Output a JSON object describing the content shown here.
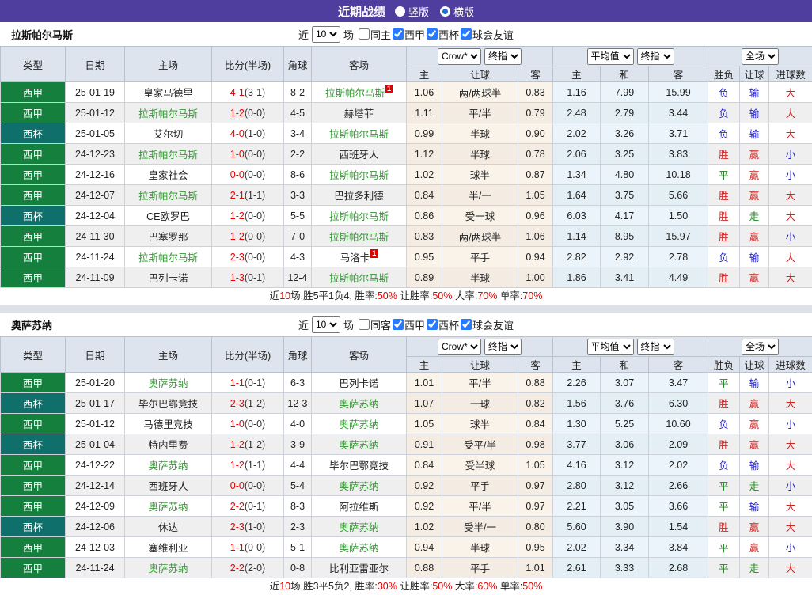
{
  "title_bar": {
    "title": "近期战绩",
    "radios": [
      {
        "label": "竖版",
        "selected": false
      },
      {
        "label": "横版",
        "selected": true
      }
    ]
  },
  "colors": {
    "accent_purple": "#4f3e9d",
    "liga_badge_green": "#15803d",
    "cup_badge_teal": "#0e6f6b",
    "focus_team_green": "#339933",
    "score_red": "#e60000",
    "result_red": "#d02525",
    "result_green": "#1f8a1f",
    "result_blue": "#2525cc",
    "crow_col_bg": "#faf3ea",
    "avg_col_bg": "#eaf4fa",
    "header_bg": "#dee4ed"
  },
  "sections": [
    {
      "team": "拉斯帕尔马斯",
      "filters": {
        "near_label": "近",
        "count": "10",
        "games_label": "场",
        "checks": [
          {
            "label": "同主",
            "checked": false
          },
          {
            "label": "西甲",
            "checked": true
          },
          {
            "label": "西杯",
            "checked": true
          },
          {
            "label": "球会友谊",
            "checked": true
          }
        ]
      },
      "header": {
        "cols": [
          "类型",
          "日期",
          "主场",
          "比分(半场)",
          "角球",
          "客场"
        ],
        "selects": {
          "crow": "Crow*",
          "final1": "终指",
          "avg": "平均值",
          "final2": "终指",
          "full": "全场"
        },
        "subs": [
          "主",
          "让球",
          "客",
          "主",
          "和",
          "客",
          "胜负",
          "让球",
          "进球数"
        ]
      },
      "rows": [
        {
          "league": "西甲",
          "date": "25-01-19",
          "home": "皇家马德里",
          "homeGreen": false,
          "homeCard": "",
          "score": "4-1",
          "half": "(3-1)",
          "corner": "8-2",
          "away": "拉斯帕尔马斯",
          "awayGreen": true,
          "awayCard": "1",
          "crowHome": "1.06",
          "handicap": "两/两球半",
          "crowAway": "0.83",
          "avgHome": "1.16",
          "avgDraw": "7.99",
          "avgAway": "15.99",
          "resWdl": "负",
          "resHandicap": "输",
          "resGoals": "大"
        },
        {
          "league": "西甲",
          "date": "25-01-12",
          "home": "拉斯帕尔马斯",
          "homeGreen": true,
          "homeCard": "",
          "score": "1-2",
          "half": "(0-0)",
          "corner": "4-5",
          "away": "赫塔菲",
          "awayGreen": false,
          "awayCard": "",
          "crowHome": "1.11",
          "handicap": "平/半",
          "crowAway": "0.79",
          "avgHome": "2.48",
          "avgDraw": "2.79",
          "avgAway": "3.44",
          "resWdl": "负",
          "resHandicap": "输",
          "resGoals": "大"
        },
        {
          "league": "西杯",
          "date": "25-01-05",
          "home": "艾尔切",
          "homeGreen": false,
          "homeCard": "",
          "score": "4-0",
          "half": "(1-0)",
          "corner": "3-4",
          "away": "拉斯帕尔马斯",
          "awayGreen": true,
          "awayCard": "",
          "crowHome": "0.99",
          "handicap": "半球",
          "crowAway": "0.90",
          "avgHome": "2.02",
          "avgDraw": "3.26",
          "avgAway": "3.71",
          "resWdl": "负",
          "resHandicap": "输",
          "resGoals": "大"
        },
        {
          "league": "西甲",
          "date": "24-12-23",
          "home": "拉斯帕尔马斯",
          "homeGreen": true,
          "homeCard": "",
          "score": "1-0",
          "half": "(0-0)",
          "corner": "2-2",
          "away": "西班牙人",
          "awayGreen": false,
          "awayCard": "",
          "crowHome": "1.12",
          "handicap": "半球",
          "crowAway": "0.78",
          "avgHome": "2.06",
          "avgDraw": "3.25",
          "avgAway": "3.83",
          "resWdl": "胜",
          "resHandicap": "赢",
          "resGoals": "小"
        },
        {
          "league": "西甲",
          "date": "24-12-16",
          "home": "皇家社会",
          "homeGreen": false,
          "homeCard": "",
          "score": "0-0",
          "half": "(0-0)",
          "corner": "8-6",
          "away": "拉斯帕尔马斯",
          "awayGreen": true,
          "awayCard": "",
          "crowHome": "1.02",
          "handicap": "球半",
          "crowAway": "0.87",
          "avgHome": "1.34",
          "avgDraw": "4.80",
          "avgAway": "10.18",
          "resWdl": "平",
          "resHandicap": "赢",
          "resGoals": "小"
        },
        {
          "league": "西甲",
          "date": "24-12-07",
          "home": "拉斯帕尔马斯",
          "homeGreen": true,
          "homeCard": "",
          "score": "2-1",
          "half": "(1-1)",
          "corner": "3-3",
          "away": "巴拉多利德",
          "awayGreen": false,
          "awayCard": "",
          "crowHome": "0.84",
          "handicap": "半/一",
          "crowAway": "1.05",
          "avgHome": "1.64",
          "avgDraw": "3.75",
          "avgAway": "5.66",
          "resWdl": "胜",
          "resHandicap": "赢",
          "resGoals": "大"
        },
        {
          "league": "西杯",
          "date": "24-12-04",
          "home": "CE欧罗巴",
          "homeGreen": false,
          "homeCard": "",
          "score": "1-2",
          "half": "(0-0)",
          "corner": "5-5",
          "away": "拉斯帕尔马斯",
          "awayGreen": true,
          "awayCard": "",
          "crowHome": "0.86",
          "handicap": "受一球",
          "crowAway": "0.96",
          "avgHome": "6.03",
          "avgDraw": "4.17",
          "avgAway": "1.50",
          "resWdl": "胜",
          "resHandicap": "走",
          "resGoals": "大"
        },
        {
          "league": "西甲",
          "date": "24-11-30",
          "home": "巴塞罗那",
          "homeGreen": false,
          "homeCard": "",
          "score": "1-2",
          "half": "(0-0)",
          "corner": "7-0",
          "away": "拉斯帕尔马斯",
          "awayGreen": true,
          "awayCard": "",
          "crowHome": "0.83",
          "handicap": "两/两球半",
          "crowAway": "1.06",
          "avgHome": "1.14",
          "avgDraw": "8.95",
          "avgAway": "15.97",
          "resWdl": "胜",
          "resHandicap": "赢",
          "resGoals": "小"
        },
        {
          "league": "西甲",
          "date": "24-11-24",
          "home": "拉斯帕尔马斯",
          "homeGreen": true,
          "homeCard": "",
          "score": "2-3",
          "half": "(0-0)",
          "corner": "4-3",
          "away": "马洛卡",
          "awayGreen": false,
          "awayCard": "1",
          "crowHome": "0.95",
          "handicap": "平手",
          "crowAway": "0.94",
          "avgHome": "2.82",
          "avgDraw": "2.92",
          "avgAway": "2.78",
          "resWdl": "负",
          "resHandicap": "输",
          "resGoals": "大"
        },
        {
          "league": "西甲",
          "date": "24-11-09",
          "home": "巴列卡诺",
          "homeGreen": false,
          "homeCard": "",
          "score": "1-3",
          "half": "(0-1)",
          "corner": "12-4",
          "away": "拉斯帕尔马斯",
          "awayGreen": true,
          "awayCard": "",
          "crowHome": "0.89",
          "handicap": "半球",
          "crowAway": "1.00",
          "avgHome": "1.86",
          "avgDraw": "3.41",
          "avgAway": "4.49",
          "resWdl": "胜",
          "resHandicap": "赢",
          "resGoals": "大"
        }
      ],
      "summary": [
        {
          "t": "近",
          "red": false
        },
        {
          "t": "10",
          "red": true
        },
        {
          "t": "场,胜5平1负4, 胜率:",
          "red": false
        },
        {
          "t": "50%",
          "red": true
        },
        {
          "t": " 让胜率:",
          "red": false
        },
        {
          "t": "50%",
          "red": true
        },
        {
          "t": " 大率:",
          "red": false
        },
        {
          "t": "70%",
          "red": true
        },
        {
          "t": " 单率:",
          "red": false
        },
        {
          "t": "70%",
          "red": true
        }
      ]
    },
    {
      "team": "奥萨苏纳",
      "filters": {
        "near_label": "近",
        "count": "10",
        "games_label": "场",
        "checks": [
          {
            "label": "同客",
            "checked": false
          },
          {
            "label": "西甲",
            "checked": true
          },
          {
            "label": "西杯",
            "checked": true
          },
          {
            "label": "球会友谊",
            "checked": true
          }
        ]
      },
      "header": {
        "cols": [
          "类型",
          "日期",
          "主场",
          "比分(半场)",
          "角球",
          "客场"
        ],
        "selects": {
          "crow": "Crow*",
          "final1": "终指",
          "avg": "平均值",
          "final2": "终指",
          "full": "全场"
        },
        "subs": [
          "主",
          "让球",
          "客",
          "主",
          "和",
          "客",
          "胜负",
          "让球",
          "进球数"
        ]
      },
      "rows": [
        {
          "league": "西甲",
          "date": "25-01-20",
          "home": "奥萨苏纳",
          "homeGreen": true,
          "homeCard": "",
          "score": "1-1",
          "half": "(0-1)",
          "corner": "6-3",
          "away": "巴列卡诺",
          "awayGreen": false,
          "awayCard": "",
          "crowHome": "1.01",
          "handicap": "平/半",
          "crowAway": "0.88",
          "avgHome": "2.26",
          "avgDraw": "3.07",
          "avgAway": "3.47",
          "resWdl": "平",
          "resHandicap": "输",
          "resGoals": "小"
        },
        {
          "league": "西杯",
          "date": "25-01-17",
          "home": "毕尔巴鄂竞技",
          "homeGreen": false,
          "homeCard": "",
          "score": "2-3",
          "half": "(1-2)",
          "corner": "12-3",
          "away": "奥萨苏纳",
          "awayGreen": true,
          "awayCard": "",
          "crowHome": "1.07",
          "handicap": "一球",
          "crowAway": "0.82",
          "avgHome": "1.56",
          "avgDraw": "3.76",
          "avgAway": "6.30",
          "resWdl": "胜",
          "resHandicap": "赢",
          "resGoals": "大"
        },
        {
          "league": "西甲",
          "date": "25-01-12",
          "home": "马德里竞技",
          "homeGreen": false,
          "homeCard": "",
          "score": "1-0",
          "half": "(0-0)",
          "corner": "4-0",
          "away": "奥萨苏纳",
          "awayGreen": true,
          "awayCard": "",
          "crowHome": "1.05",
          "handicap": "球半",
          "crowAway": "0.84",
          "avgHome": "1.30",
          "avgDraw": "5.25",
          "avgAway": "10.60",
          "resWdl": "负",
          "resHandicap": "赢",
          "resGoals": "小"
        },
        {
          "league": "西杯",
          "date": "25-01-04",
          "home": "特内里费",
          "homeGreen": false,
          "homeCard": "",
          "score": "1-2",
          "half": "(1-2)",
          "corner": "3-9",
          "away": "奥萨苏纳",
          "awayGreen": true,
          "awayCard": "",
          "crowHome": "0.91",
          "handicap": "受平/半",
          "crowAway": "0.98",
          "avgHome": "3.77",
          "avgDraw": "3.06",
          "avgAway": "2.09",
          "resWdl": "胜",
          "resHandicap": "赢",
          "resGoals": "大"
        },
        {
          "league": "西甲",
          "date": "24-12-22",
          "home": "奥萨苏纳",
          "homeGreen": true,
          "homeCard": "",
          "score": "1-2",
          "half": "(1-1)",
          "corner": "4-4",
          "away": "毕尔巴鄂竞技",
          "awayGreen": false,
          "awayCard": "",
          "crowHome": "0.84",
          "handicap": "受半球",
          "crowAway": "1.05",
          "avgHome": "4.16",
          "avgDraw": "3.12",
          "avgAway": "2.02",
          "resWdl": "负",
          "resHandicap": "输",
          "resGoals": "大"
        },
        {
          "league": "西甲",
          "date": "24-12-14",
          "home": "西班牙人",
          "homeGreen": false,
          "homeCard": "",
          "score": "0-0",
          "half": "(0-0)",
          "corner": "5-4",
          "away": "奥萨苏纳",
          "awayGreen": true,
          "awayCard": "",
          "crowHome": "0.92",
          "handicap": "平手",
          "crowAway": "0.97",
          "avgHome": "2.80",
          "avgDraw": "3.12",
          "avgAway": "2.66",
          "resWdl": "平",
          "resHandicap": "走",
          "resGoals": "小"
        },
        {
          "league": "西甲",
          "date": "24-12-09",
          "home": "奥萨苏纳",
          "homeGreen": true,
          "homeCard": "",
          "score": "2-2",
          "half": "(0-1)",
          "corner": "8-3",
          "away": "阿拉维斯",
          "awayGreen": false,
          "awayCard": "",
          "crowHome": "0.92",
          "handicap": "平/半",
          "crowAway": "0.97",
          "avgHome": "2.21",
          "avgDraw": "3.05",
          "avgAway": "3.66",
          "resWdl": "平",
          "resHandicap": "输",
          "resGoals": "大"
        },
        {
          "league": "西杯",
          "date": "24-12-06",
          "home": "休达",
          "homeGreen": false,
          "homeCard": "",
          "score": "2-3",
          "half": "(1-0)",
          "corner": "2-3",
          "away": "奥萨苏纳",
          "awayGreen": true,
          "awayCard": "",
          "crowHome": "1.02",
          "handicap": "受半/一",
          "crowAway": "0.80",
          "avgHome": "5.60",
          "avgDraw": "3.90",
          "avgAway": "1.54",
          "resWdl": "胜",
          "resHandicap": "赢",
          "resGoals": "大"
        },
        {
          "league": "西甲",
          "date": "24-12-03",
          "home": "塞维利亚",
          "homeGreen": false,
          "homeCard": "",
          "score": "1-1",
          "half": "(0-0)",
          "corner": "5-1",
          "away": "奥萨苏纳",
          "awayGreen": true,
          "awayCard": "",
          "crowHome": "0.94",
          "handicap": "半球",
          "crowAway": "0.95",
          "avgHome": "2.02",
          "avgDraw": "3.34",
          "avgAway": "3.84",
          "resWdl": "平",
          "resHandicap": "赢",
          "resGoals": "小"
        },
        {
          "league": "西甲",
          "date": "24-11-24",
          "home": "奥萨苏纳",
          "homeGreen": true,
          "homeCard": "",
          "score": "2-2",
          "half": "(2-0)",
          "corner": "0-8",
          "away": "比利亚雷亚尔",
          "awayGreen": false,
          "awayCard": "",
          "crowHome": "0.88",
          "handicap": "平手",
          "crowAway": "1.01",
          "avgHome": "2.61",
          "avgDraw": "3.33",
          "avgAway": "2.68",
          "resWdl": "平",
          "resHandicap": "走",
          "resGoals": "大"
        }
      ],
      "summary": [
        {
          "t": "近",
          "red": false
        },
        {
          "t": "10",
          "red": true
        },
        {
          "t": "场,胜3平5负2, 胜率:",
          "red": false
        },
        {
          "t": "30%",
          "red": true
        },
        {
          "t": " 让胜率:",
          "red": false
        },
        {
          "t": "50%",
          "red": true
        },
        {
          "t": " 大率:",
          "red": false
        },
        {
          "t": "60%",
          "red": true
        },
        {
          "t": " 单率:",
          "red": false
        },
        {
          "t": "50%",
          "red": true
        }
      ]
    }
  ]
}
